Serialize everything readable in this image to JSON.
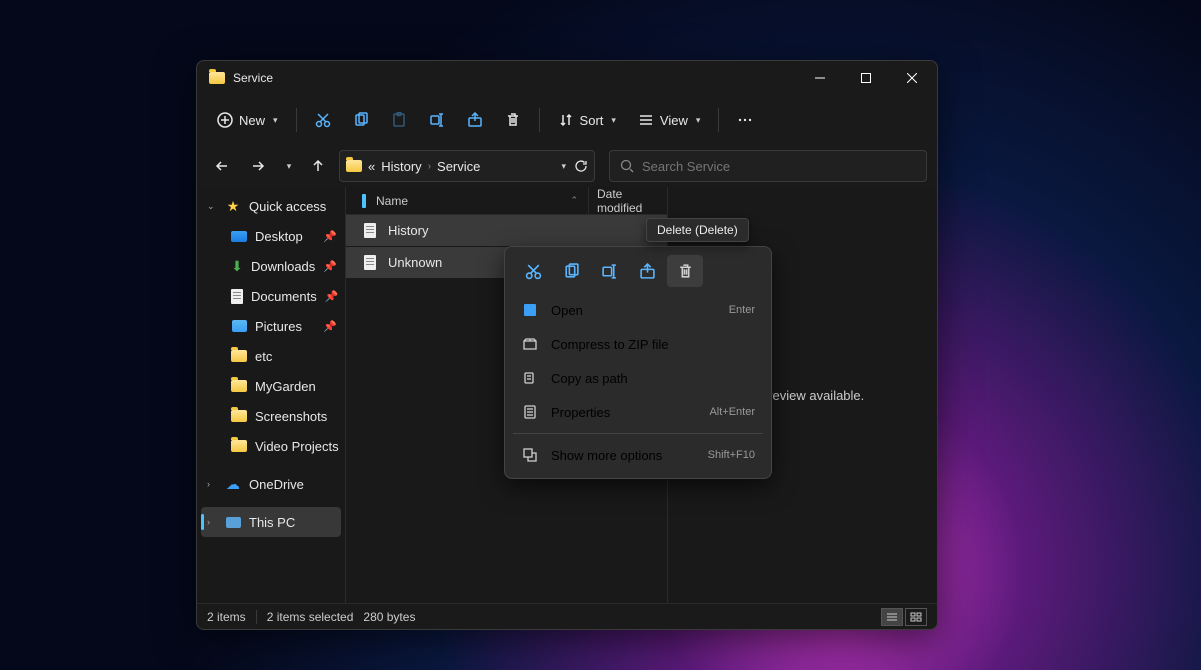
{
  "title": "Service",
  "toolbar": {
    "new": "New",
    "sort": "Sort",
    "view": "View"
  },
  "breadcrumb": {
    "prefix": "«",
    "seg1": "History",
    "seg2": "Service"
  },
  "search": {
    "placeholder": "Search Service"
  },
  "sidebar": {
    "quick": "Quick access",
    "desktop": "Desktop",
    "downloads": "Downloads",
    "documents": "Documents",
    "pictures": "Pictures",
    "etc": "etc",
    "mygarden": "MyGarden",
    "screenshots": "Screenshots",
    "videoproj": "Video Projects",
    "onedrive": "OneDrive",
    "thispc": "This PC"
  },
  "columns": {
    "name": "Name",
    "date": "Date modified"
  },
  "files": {
    "f1": "History",
    "f2": "Unknown"
  },
  "preview": "No preview available.",
  "status": {
    "items": "2 items",
    "selected": "2 items selected",
    "size": "280 bytes"
  },
  "tooltip": "Delete (Delete)",
  "ctx": {
    "open": "Open",
    "open_s": "Enter",
    "zip": "Compress to ZIP file",
    "copypath": "Copy as path",
    "props": "Properties",
    "props_s": "Alt+Enter",
    "more": "Show more options",
    "more_s": "Shift+F10"
  }
}
